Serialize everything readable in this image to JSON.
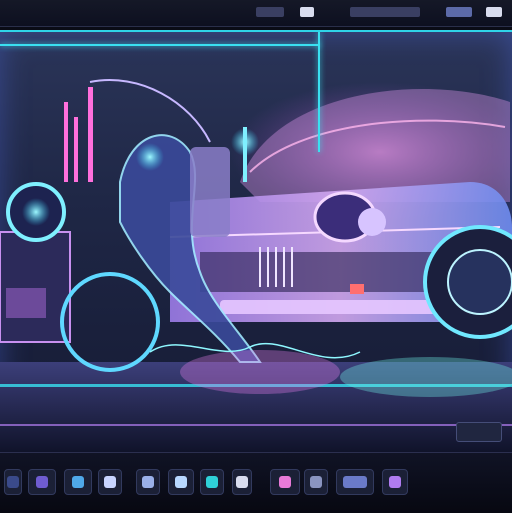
{
  "window": {
    "title": ""
  },
  "canvas": {
    "artwork_description_icon": "neon-car-artwork",
    "colors": {
      "accent": "#3ae0f0",
      "pink": "#e06fe8",
      "violet": "#8a6cf0"
    }
  },
  "toolbar": {
    "items": [
      {
        "icon": "panel-icon"
      },
      {
        "icon": "layers-icon"
      },
      {
        "icon": "brush-icon"
      },
      {
        "icon": "pen-icon"
      },
      {
        "icon": "shape-icon"
      },
      {
        "icon": "image-icon"
      },
      {
        "icon": "globe-icon"
      },
      {
        "icon": "link-icon"
      },
      {
        "icon": "shapes-icon"
      },
      {
        "icon": "frame-icon"
      },
      {
        "icon": "text-icon"
      },
      {
        "icon": "export-icon"
      }
    ]
  }
}
